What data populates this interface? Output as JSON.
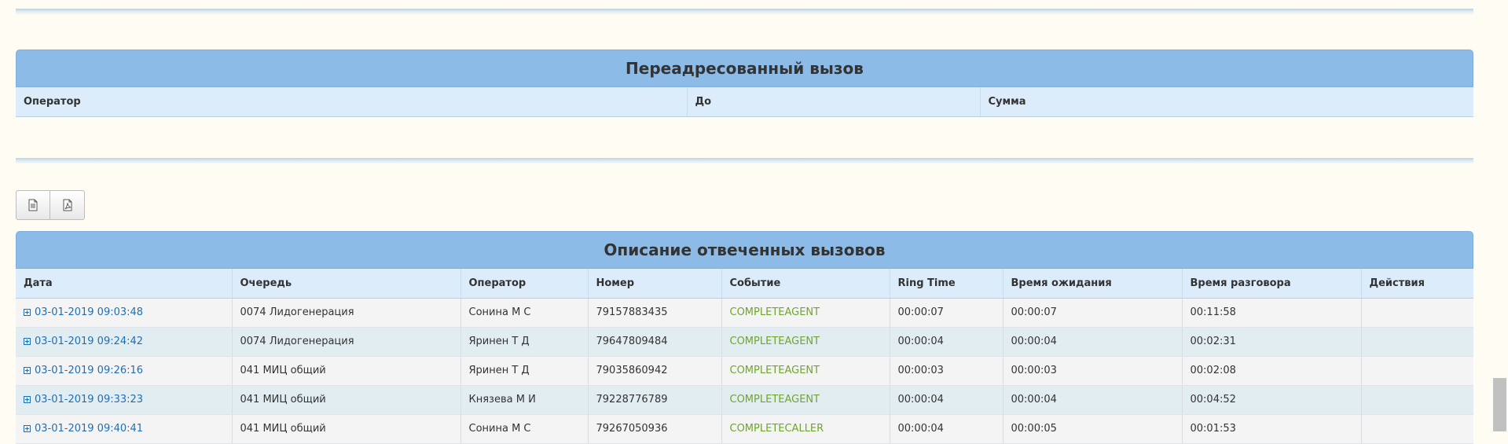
{
  "forwarded": {
    "title": "Переадресованный вызов",
    "columns": [
      "Оператор",
      "До",
      "Сумма"
    ]
  },
  "export": {
    "buttons": [
      {
        "icon": "document-icon"
      },
      {
        "icon": "pdf-icon"
      }
    ]
  },
  "answered": {
    "title": "Описание отвеченных вызовов",
    "columns": [
      "Дата",
      "Очередь",
      "Оператор",
      "Номер",
      "Событие",
      "Ring Time",
      "Время ожидания",
      "Время разговора",
      "Действия"
    ],
    "rows": [
      {
        "date": "03-01-2019 09:03:48",
        "queue": "0074 Лидогенерация",
        "operator": "Сонина М С",
        "number": "79157883435",
        "event": "COMPLETEAGENT",
        "ring": "00:00:07",
        "wait": "00:00:07",
        "talk": "00:11:58",
        "actions": ""
      },
      {
        "date": "03-01-2019 09:24:42",
        "queue": "0074 Лидогенерация",
        "operator": "Яринен Т Д",
        "number": "79647809484",
        "event": "COMPLETEAGENT",
        "ring": "00:00:04",
        "wait": "00:00:04",
        "talk": "00:02:31",
        "actions": ""
      },
      {
        "date": "03-01-2019 09:26:16",
        "queue": "041 МИЦ общий",
        "operator": "Яринен Т Д",
        "number": "79035860942",
        "event": "COMPLETEAGENT",
        "ring": "00:00:03",
        "wait": "00:00:03",
        "talk": "00:02:08",
        "actions": ""
      },
      {
        "date": "03-01-2019 09:33:23",
        "queue": "041 МИЦ общий",
        "operator": "Князева М И",
        "number": "79228776789",
        "event": "COMPLETEAGENT",
        "ring": "00:00:04",
        "wait": "00:00:04",
        "talk": "00:04:52",
        "actions": ""
      },
      {
        "date": "03-01-2019 09:40:41",
        "queue": "041 МИЦ общий",
        "operator": "Сонина М С",
        "number": "79267050936",
        "event": "COMPLETECALLER",
        "ring": "00:00:04",
        "wait": "00:00:05",
        "talk": "00:01:53",
        "actions": ""
      }
    ]
  },
  "colors": {
    "panel_header": "#8bbbe6",
    "table_header": "#dcecfb",
    "link": "#1f6fb5",
    "event": "#6fa52c",
    "background": "#fffcf4"
  }
}
